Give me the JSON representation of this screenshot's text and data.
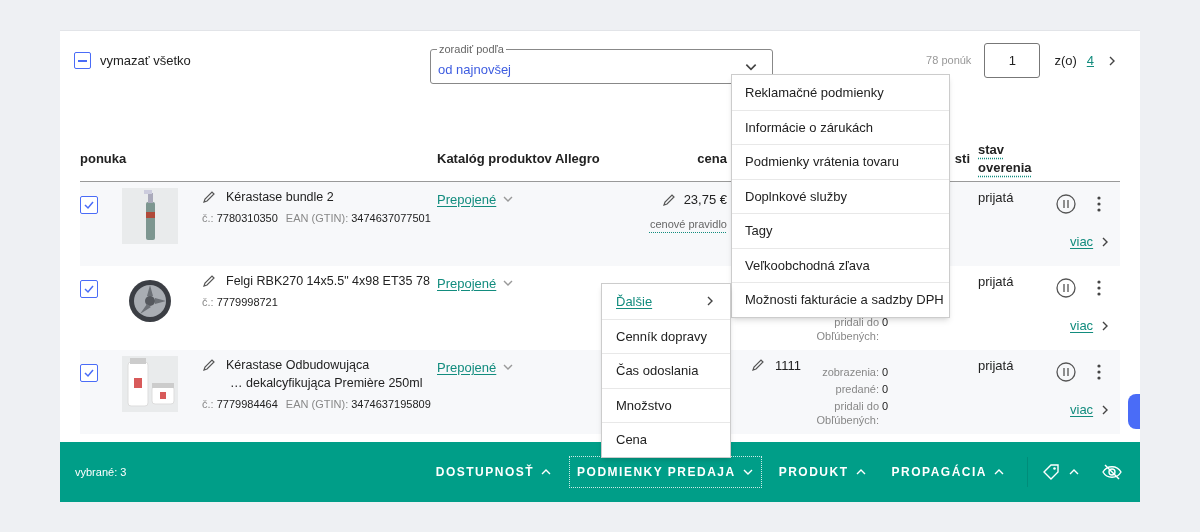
{
  "toolbar": {
    "clear_all": {
      "label": "vymazať všetko",
      "indeterminate": true
    },
    "sort": {
      "label": "zoradiť podľa",
      "value": "od najnovšej",
      "expanded": false
    },
    "pagination": {
      "count": "78 ponúk",
      "page": "1",
      "of_label": "z(o)",
      "total": "4"
    }
  },
  "table": {
    "columns": [
      "ponuka",
      "Katalóg produktov Allegro",
      "cena",
      "sti",
      "stav overenia"
    ],
    "rows": [
      {
        "checked": true,
        "name": [
          "Kérastase bundle 2"
        ],
        "id_label": "č.:",
        "id": "7780310350",
        "ean_label": "EAN (GTIN):",
        "ean": "3474637077501",
        "catalog": "Prepojené",
        "catalog_expanded": false,
        "price": "23,75 €",
        "price_rule": "cenové pravidlo",
        "status": "prijatá",
        "more": "viac"
      },
      {
        "checked": true,
        "name": [
          "Felgi RBK270 14x5.5\" 4x98 ET35 78"
        ],
        "id_label": "č.:",
        "id": "7779998721",
        "catalog": "Prepojené",
        "catalog_expanded": false,
        "stats": [
          {
            "label": "pridali do Obľúbených:",
            "value": "0"
          }
        ],
        "status": "prijatá",
        "more": "viac"
      },
      {
        "checked": true,
        "name": [
          "Kérastase Odbudowująca",
          "… dekalcyfikująca Première 250ml"
        ],
        "id_label": "č.:",
        "id": "7779984464",
        "ean_label": "EAN (GTIN):",
        "ean": "3474637195809",
        "catalog": "Prepojené",
        "catalog_expanded": false,
        "quantity": "1111",
        "stats": [
          {
            "label": "zobrazenia:",
            "value": "0"
          },
          {
            "label": "predané:",
            "value": "0"
          },
          {
            "label": "pridali do Obľúbených:",
            "value": "0"
          }
        ],
        "status": "prijatá",
        "more": "viac"
      }
    ]
  },
  "conditions_menu": {
    "items": [
      {
        "label": "Reklamačné podmienky"
      },
      {
        "label": "Informácie o zárukách"
      },
      {
        "label": "Podmienky vrátenia tovaru"
      },
      {
        "label": "Doplnkové služby"
      },
      {
        "label": "Tagy"
      },
      {
        "label": "Veľkoobchodná zľava"
      },
      {
        "label": "Možnosti fakturácie a sadzby DPH"
      }
    ]
  },
  "sales_menu": {
    "items": [
      {
        "label": "Ďalšie",
        "kind": "submenu"
      },
      {
        "label": "Cenník dopravy",
        "kind": "item"
      },
      {
        "label": "Čas odoslania",
        "kind": "item"
      },
      {
        "label": "Množstvo",
        "kind": "item"
      },
      {
        "label": "Cena",
        "kind": "item"
      }
    ]
  },
  "bottom_bar": {
    "selected": "vybrané: 3",
    "tabs": [
      {
        "label": "DOSTUPNOSŤ",
        "expanded": false
      },
      {
        "label": "PODMIENKY PREDAJA",
        "expanded": true
      },
      {
        "label": "PRODUKT",
        "expanded": false
      },
      {
        "label": "PROPAGÁCIA",
        "expanded": false
      }
    ],
    "tag_expanded": false
  }
}
